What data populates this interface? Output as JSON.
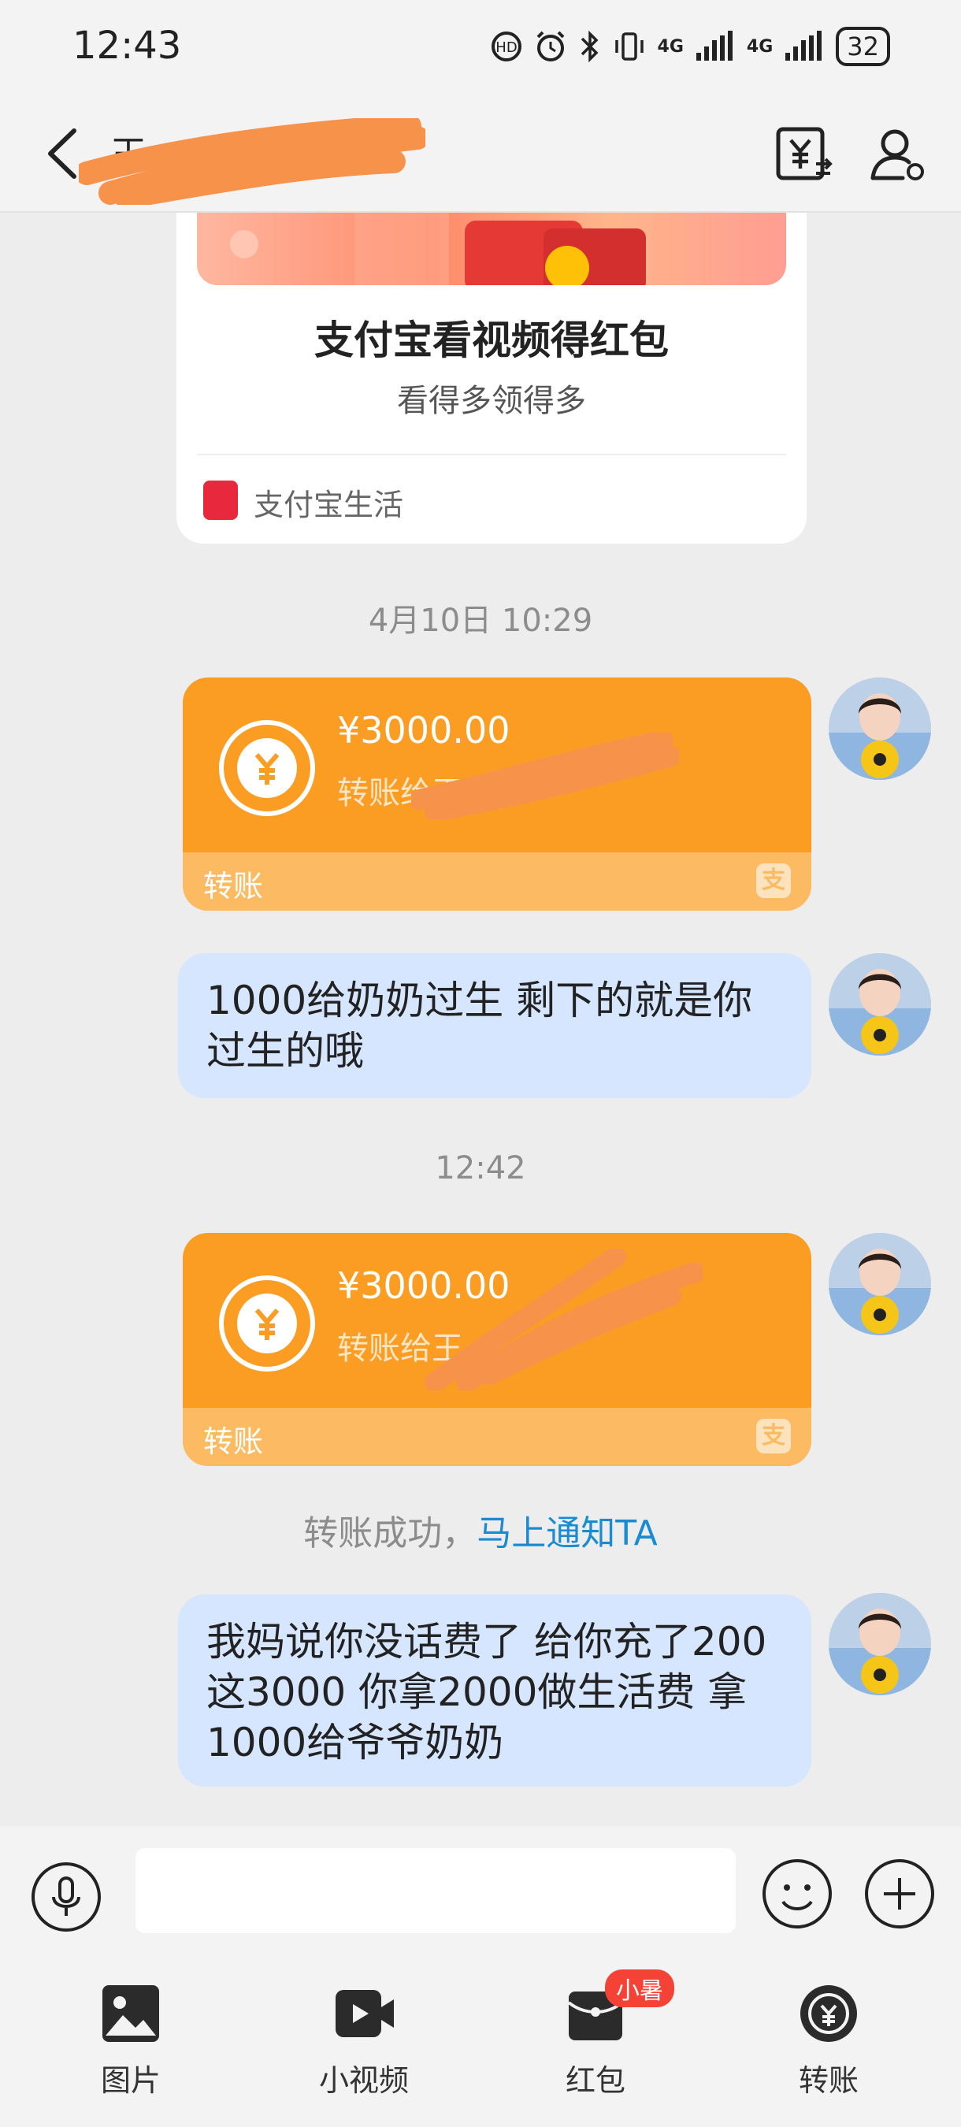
{
  "status_bar": {
    "time": "12:43",
    "battery": "32",
    "network_1": "4G",
    "network_2": "4G"
  },
  "header": {
    "contact_name": "王",
    "transfer_icon": "yuan-transfer-icon",
    "profile_icon": "profile-settings-icon"
  },
  "promo_card": {
    "title": "支付宝看视频得红包",
    "subtitle": "看得多领得多",
    "source": "支付宝生活"
  },
  "messages": {
    "time_1": "4月10日 10:29",
    "transfer_1": {
      "amount": "¥3000.00",
      "to": "转账给王",
      "label": "转账",
      "alipay": "支"
    },
    "text_1": "1000给奶奶过生 剩下的就是你过生的哦",
    "time_2": "12:42",
    "transfer_2": {
      "amount": "¥3000.00",
      "to": "转账给王",
      "label": "转账",
      "alipay": "支"
    },
    "transfer_status": "转账成功，",
    "notify_link": "马上通知TA",
    "text_2": "我妈说你没话费了 给你充了200 这3000 你拿2000做生活费 拿1000给爷爷奶奶"
  },
  "input_bar": {
    "placeholder": ""
  },
  "toolbar": {
    "photo_label": "图片",
    "video_label": "小视频",
    "red_packet_label": "红包",
    "red_packet_badge": "小暑",
    "transfer_label": "转账"
  },
  "colors": {
    "transfer_orange": "#fa9d22",
    "bubble_blue": "#d6e6ff",
    "link_blue": "#1a8ad1",
    "redaction_orange": "#f7924a"
  }
}
